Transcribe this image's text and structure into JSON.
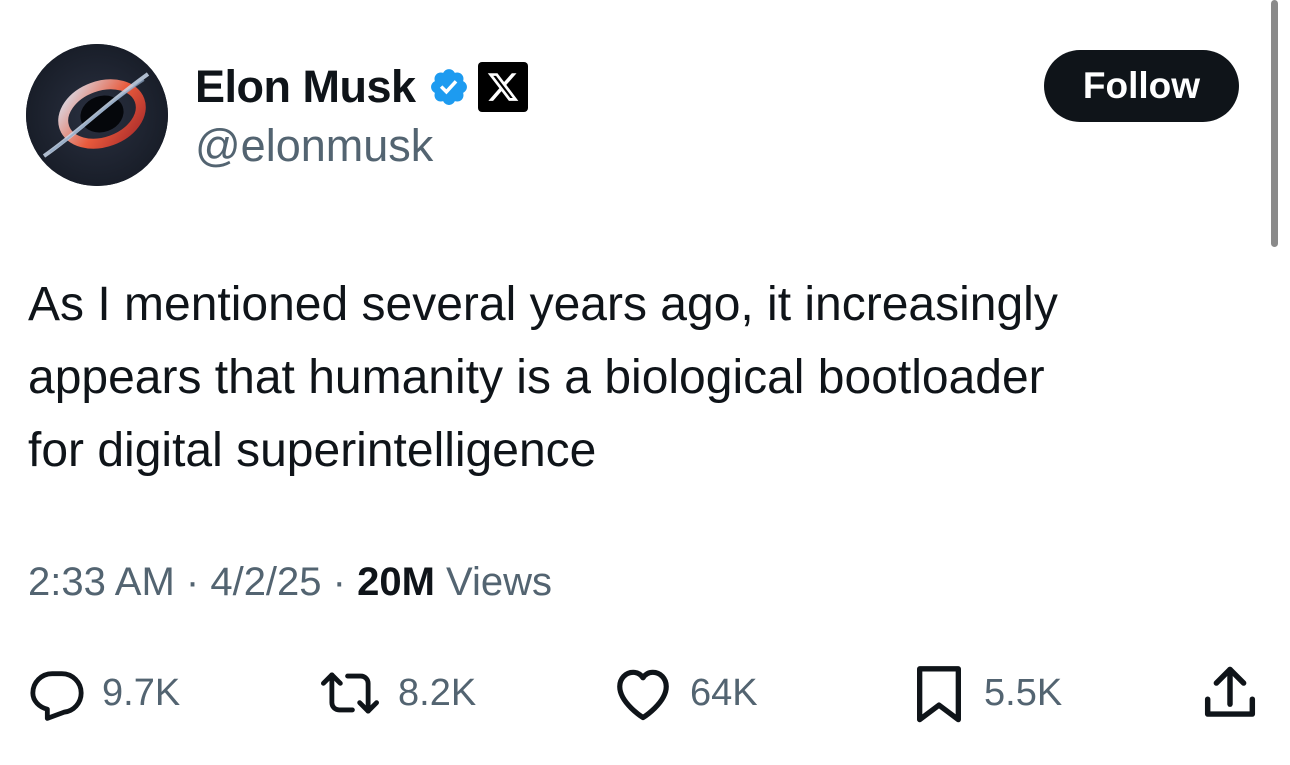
{
  "author": {
    "display_name": "Elon Musk",
    "handle": "@elonmusk",
    "verified_icon": "verified-badge-icon",
    "affiliate_icon": "x-logo-icon"
  },
  "follow_button": {
    "label": "Follow"
  },
  "tweet": {
    "text_lines": [
      "As I mentioned several years ago, it increasingly",
      "appears that humanity is a biological bootloader",
      "for digital superintelligence"
    ]
  },
  "meta": {
    "time": "2:33 AM",
    "separator": "·",
    "date": "4/2/25",
    "views_count": "20M",
    "views_label": "Views"
  },
  "actions": {
    "replies": {
      "icon": "reply-icon",
      "count": "9.7K"
    },
    "reposts": {
      "icon": "repost-icon",
      "count": "8.2K"
    },
    "likes": {
      "icon": "heart-icon",
      "count": "64K"
    },
    "bookmarks": {
      "icon": "bookmark-icon",
      "count": "5.5K"
    },
    "share": {
      "icon": "share-icon"
    }
  },
  "colors": {
    "text_primary": "#0f1419",
    "text_secondary": "#536471",
    "verified_blue": "#1d9bf0",
    "follow_button_bg": "#0f1419"
  }
}
